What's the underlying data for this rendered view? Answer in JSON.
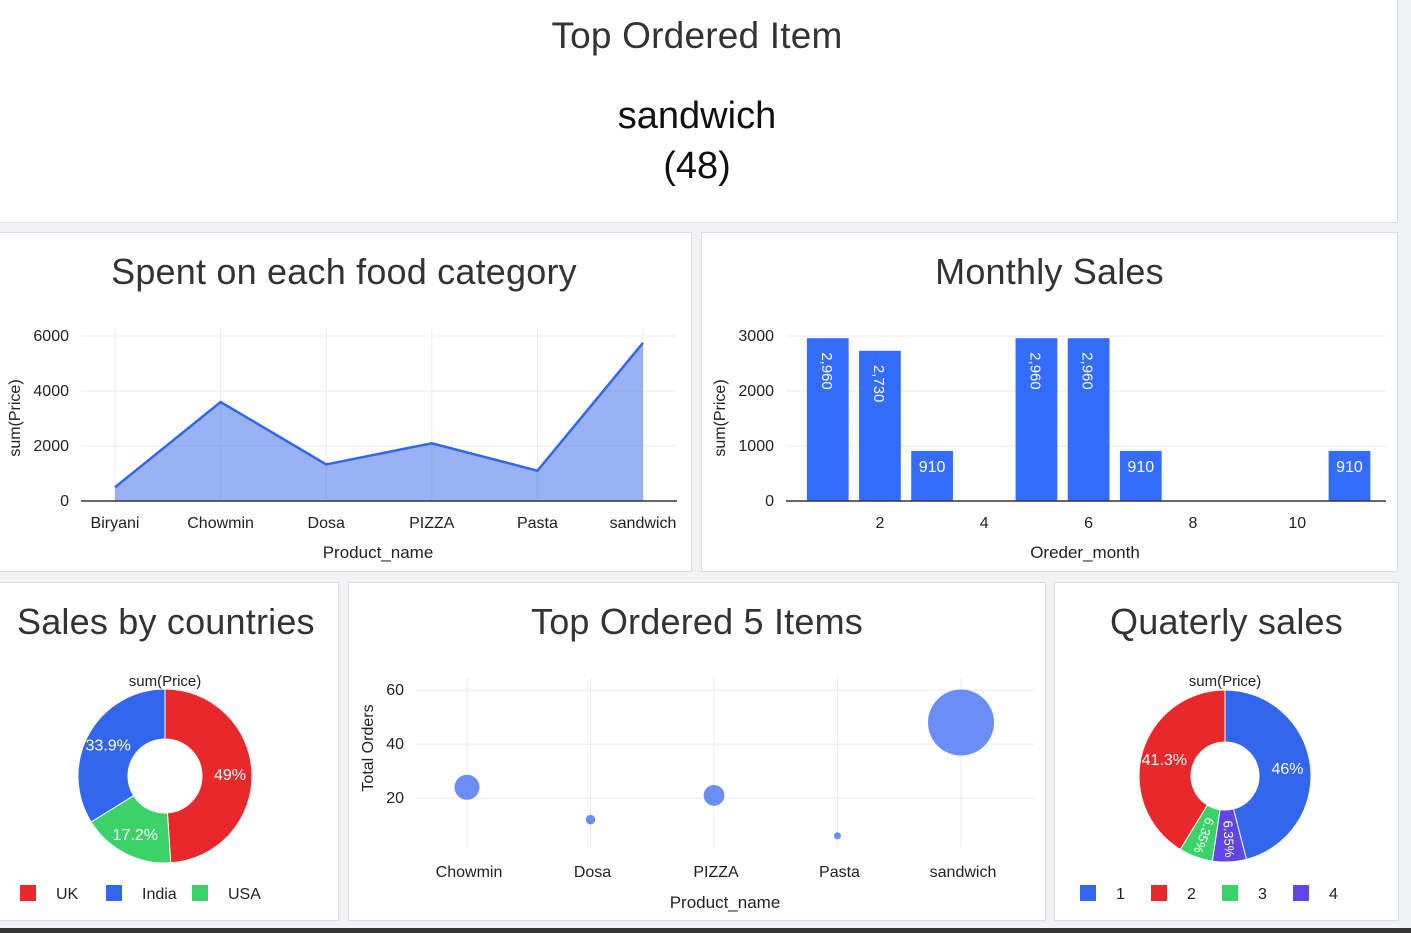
{
  "kpi": {
    "title": "Top Ordered Item",
    "item": "sandwich",
    "count": "(48)"
  },
  "chart_data": [
    {
      "id": "food_category",
      "type": "area",
      "title": "Spent on each food category",
      "xlabel": "Product_name",
      "ylabel": "sum(Price)",
      "categories": [
        "Biryani",
        "Chowmin",
        "Dosa",
        "PIZZA",
        "Pasta",
        "sandwich"
      ],
      "values": [
        500,
        3600,
        1330,
        2100,
        1100,
        5750
      ],
      "ylim": [
        0,
        6000
      ],
      "yticks": [
        "0",
        "2000",
        "4000",
        "6000"
      ],
      "color": "#3366ee",
      "grid": true
    },
    {
      "id": "monthly_sales",
      "type": "bar",
      "title": "Monthly Sales",
      "xlabel": "Oreder_month",
      "ylabel": "sum(Price)",
      "x": [
        1,
        2,
        3,
        5,
        6,
        7,
        11
      ],
      "values": [
        2960,
        2730,
        910,
        2960,
        2960,
        910,
        910
      ],
      "labels": [
        "2,960",
        "2,730",
        "910",
        "2,960",
        "2,960",
        "910",
        "910"
      ],
      "xlim": [
        0.2,
        11.7
      ],
      "xticks": [
        "2",
        "4",
        "6",
        "8",
        "10"
      ],
      "ylim": [
        0,
        3000
      ],
      "yticks": [
        "0",
        "1000",
        "2000",
        "3000"
      ],
      "color": "#336cff",
      "grid": true
    },
    {
      "id": "sales_by_countries",
      "type": "pie",
      "title": "Sales by countries",
      "subtitle": "sum(Price)",
      "slices": [
        {
          "label": "UK",
          "value": 49,
          "text": "49%",
          "color": "#e8282b"
        },
        {
          "label": "USA",
          "value": 17.2,
          "text": "17.2%",
          "color": "#3cd26a"
        },
        {
          "label": "India",
          "value": 33.9,
          "text": "33.9%",
          "color": "#3366ee"
        }
      ],
      "legend": [
        {
          "label": "UK",
          "color": "#e8282b"
        },
        {
          "label": "India",
          "color": "#3366ee"
        },
        {
          "label": "USA",
          "color": "#3cd26a"
        }
      ],
      "legend_position": "bottom"
    },
    {
      "id": "top5_items",
      "type": "scatter",
      "title": "Top Ordered 5 Items",
      "xlabel": "Product_name",
      "ylabel": "Total Orders",
      "categories": [
        "Chowmin",
        "Dosa",
        "PIZZA",
        "Pasta",
        "sandwich"
      ],
      "values": [
        24,
        12,
        21,
        6,
        48
      ],
      "ylim": [
        0,
        66
      ],
      "yticks": [
        "20",
        "40",
        "60"
      ],
      "color": "#5b82f5",
      "grid": true
    },
    {
      "id": "quarterly_sales",
      "type": "pie",
      "title": "Quaterly sales",
      "subtitle": "sum(Price)",
      "slices": [
        {
          "label": "1",
          "value": 46,
          "text": "46%",
          "color": "#3366ee"
        },
        {
          "label": "4",
          "value": 6.35,
          "text": "6.35%",
          "color": "#6145e6"
        },
        {
          "label": "3",
          "value": 6.35,
          "text": "6.35%",
          "color": "#3cd26a"
        },
        {
          "label": "2",
          "value": 41.3,
          "text": "41.3%",
          "color": "#e8282b"
        }
      ],
      "legend": [
        {
          "label": "1",
          "color": "#3366ee"
        },
        {
          "label": "2",
          "color": "#e8282b"
        },
        {
          "label": "3",
          "color": "#3cd26a"
        },
        {
          "label": "4",
          "color": "#6145e6"
        }
      ],
      "legend_position": "bottom"
    }
  ]
}
